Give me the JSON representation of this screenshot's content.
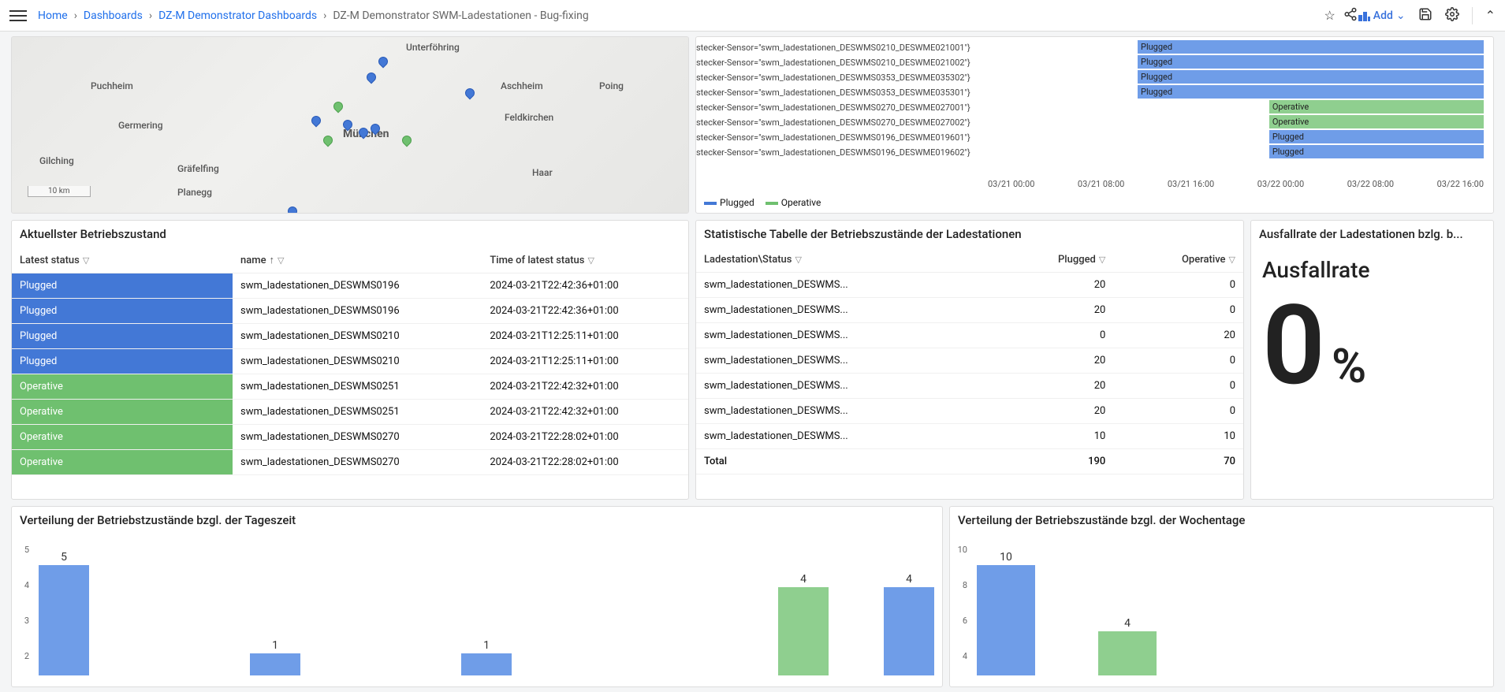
{
  "breadcrumb": {
    "home": "Home",
    "dashboards": "Dashboards",
    "parent": "DZ-M Demonstrator Dashboards",
    "current": "DZ-M Demonstrator SWM-Ladestationen - Bug-fixing"
  },
  "topbar": {
    "add": "Add"
  },
  "map": {
    "scale": "10 km",
    "labels": [
      "Unterföhring",
      "Puchheim",
      "Aschheim",
      "Poing",
      "Germering",
      "München",
      "Feldkirchen",
      "Gilching",
      "Gräfelfing",
      "Haar",
      "Planegg"
    ]
  },
  "timeline": {
    "sensors": [
      "stecker-Sensor=\"swm_ladestationen_DESWMS0210_DESWME021001\"}",
      "stecker-Sensor=\"swm_ladestationen_DESWMS0210_DESWME021002\"}",
      "stecker-Sensor=\"swm_ladestationen_DESWMS0353_DESWME035302\"}",
      "stecker-Sensor=\"swm_ladestationen_DESWMS0353_DESWME035301\"}",
      "stecker-Sensor=\"swm_ladestationen_DESWMS0270_DESWME027001\"}",
      "stecker-Sensor=\"swm_ladestationen_DESWMS0270_DESWME027002\"}",
      "stecker-Sensor=\"swm_ladestationen_DESWMS0196_DESWME019601\"}",
      "stecker-Sensor=\"swm_ladestationen_DESWMS0196_DESWME019602\"}"
    ],
    "bars": [
      "Plugged",
      "Plugged",
      "Plugged",
      "Plugged",
      "Operative",
      "Operative",
      "Plugged",
      "Plugged"
    ],
    "axis": [
      "03/21 00:00",
      "03/21 08:00",
      "03/21 16:00",
      "03/22 00:00",
      "03/22 08:00",
      "03/22 16:00"
    ],
    "legend": {
      "plugged": "Plugged",
      "operative": "Operative"
    }
  },
  "status_panel": {
    "title": "Aktuellster Betriebszustand",
    "cols": {
      "status": "Latest status",
      "name": "name",
      "time": "Time of latest status"
    },
    "rows": [
      {
        "status": "Plugged",
        "name": "swm_ladestationen_DESWMS0196",
        "time": "2024-03-21T22:42:36+01:00"
      },
      {
        "status": "Plugged",
        "name": "swm_ladestationen_DESWMS0196",
        "time": "2024-03-21T22:42:36+01:00"
      },
      {
        "status": "Plugged",
        "name": "swm_ladestationen_DESWMS0210",
        "time": "2024-03-21T12:25:11+01:00"
      },
      {
        "status": "Plugged",
        "name": "swm_ladestationen_DESWMS0210",
        "time": "2024-03-21T12:25:11+01:00"
      },
      {
        "status": "Operative",
        "name": "swm_ladestationen_DESWMS0251",
        "time": "2024-03-21T22:42:32+01:00"
      },
      {
        "status": "Operative",
        "name": "swm_ladestationen_DESWMS0251",
        "time": "2024-03-21T22:42:32+01:00"
      },
      {
        "status": "Operative",
        "name": "swm_ladestationen_DESWMS0270",
        "time": "2024-03-21T22:28:02+01:00"
      },
      {
        "status": "Operative",
        "name": "swm_ladestationen_DESWMS0270",
        "time": "2024-03-21T22:28:02+01:00"
      }
    ]
  },
  "stat_table": {
    "title": "Statistische Tabelle der Betriebszustände der Ladestationen",
    "cols": {
      "station": "Ladestation\\Status",
      "plugged": "Plugged",
      "operative": "Operative"
    },
    "rows": [
      {
        "station": "swm_ladestationen_DESWMS...",
        "plugged": "20",
        "operative": "0"
      },
      {
        "station": "swm_ladestationen_DESWMS...",
        "plugged": "20",
        "operative": "0"
      },
      {
        "station": "swm_ladestationen_DESWMS...",
        "plugged": "0",
        "operative": "20"
      },
      {
        "station": "swm_ladestationen_DESWMS...",
        "plugged": "20",
        "operative": "0"
      },
      {
        "station": "swm_ladestationen_DESWMS...",
        "plugged": "20",
        "operative": "0"
      },
      {
        "station": "swm_ladestationen_DESWMS...",
        "plugged": "20",
        "operative": "0"
      },
      {
        "station": "swm_ladestationen_DESWMS...",
        "plugged": "10",
        "operative": "10"
      }
    ],
    "total": {
      "label": "Total",
      "plugged": "190",
      "operative": "70"
    }
  },
  "ausfall": {
    "title": "Ausfallrate der Ladestationen bzlg. b...",
    "label": "Ausfallrate",
    "value": "0",
    "unit": "%"
  },
  "daytime_chart": {
    "title": "Verteilung der Betriebstzustände bzgl. der Tageszeit"
  },
  "weekday_chart": {
    "title": "Verteilung der Betriebszustände bzgl. der Wochentage"
  },
  "chart_data": [
    {
      "type": "bar",
      "title": "Verteilung der Betriebstzustände bzgl. der Tageszeit",
      "ylim": [
        0,
        5
      ],
      "yticks": [
        5,
        4,
        3,
        2
      ],
      "series": [
        {
          "name": "blue",
          "color": "#6f9de8",
          "values": [
            5,
            null,
            1,
            null,
            1,
            null,
            null,
            null,
            4
          ]
        },
        {
          "name": "green",
          "color": "#8fcf8f",
          "values": [
            null,
            null,
            null,
            null,
            null,
            null,
            null,
            4,
            null
          ]
        }
      ]
    },
    {
      "type": "bar",
      "title": "Verteilung der Betriebszustände bzgl. der Wochentage",
      "ylim": [
        0,
        10
      ],
      "yticks": [
        10,
        8,
        6,
        4
      ],
      "series": [
        {
          "name": "blue",
          "color": "#6f9de8",
          "values": [
            10,
            null
          ]
        },
        {
          "name": "green",
          "color": "#8fcf8f",
          "values": [
            null,
            4
          ]
        }
      ]
    }
  ]
}
